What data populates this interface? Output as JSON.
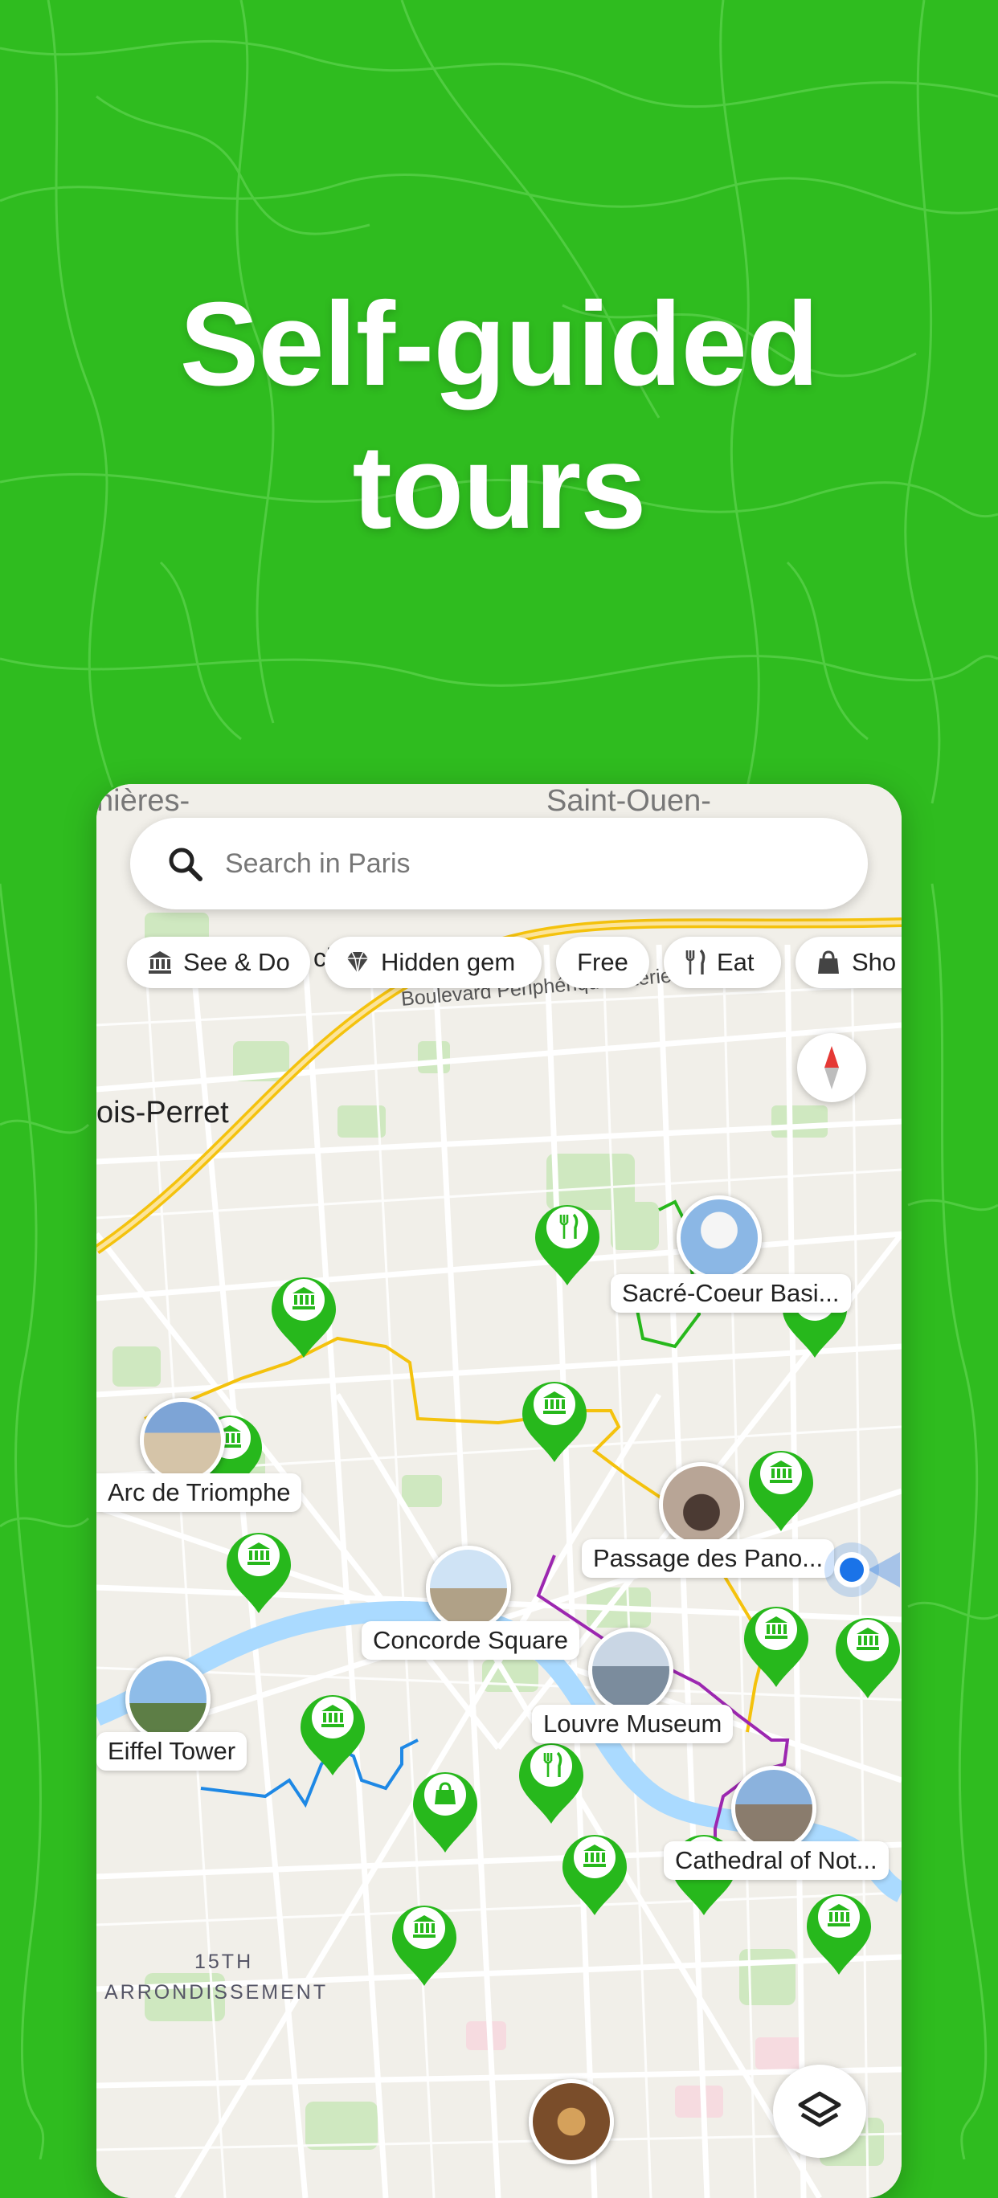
{
  "headline": {
    "line1": "Self-guided",
    "line2": "tours"
  },
  "search": {
    "placeholder": "Search in Paris"
  },
  "chips": [
    {
      "label": "See & Do",
      "icon": "museum-icon"
    },
    {
      "label": "Hidden gem",
      "icon": "diamond-icon"
    },
    {
      "label": "Free",
      "icon": ""
    },
    {
      "label": "Eat",
      "icon": "fork-knife-icon"
    },
    {
      "label": "Sho",
      "icon": "shopping-bag-icon"
    }
  ],
  "map_labels": {
    "top_left": "nières-",
    "top_right": "Saint-Ouen-",
    "levallois": "ois-Perret",
    "boulevard": "Boulevard Périphérique Intérieur",
    "arr_line1": "15TH",
    "arr_line2": "ARRONDISSEMENT",
    "partial": "cl"
  },
  "places": {
    "sacre_coeur": "Sacré-Coeur Basi...",
    "arc": "Arc de Triomphe",
    "passage": "Passage des Pano...",
    "concorde": "Concorde Square",
    "louvre": "Louvre Museum",
    "eiffel": "Eiffel Tower",
    "notre_dame": "Cathedral of Not..."
  },
  "colors": {
    "background": "#2fbc1f",
    "pin": "#27b81c",
    "route_yellow": "#f4c20d",
    "route_purple": "#9c27b0",
    "route_blue": "#1e88e5",
    "location_blue": "#1a73e8"
  }
}
